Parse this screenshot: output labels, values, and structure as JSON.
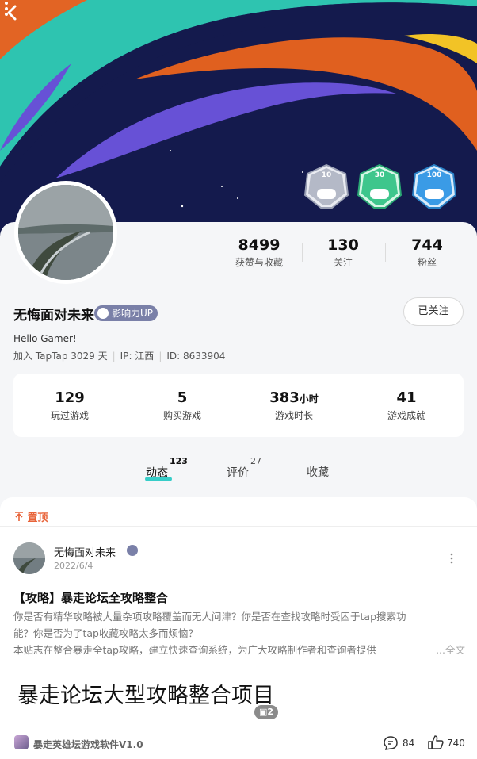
{
  "profile": {
    "name": "无悔面对未来",
    "badge": "影响力UP",
    "follow_label": "已关注",
    "bio": "Hello Gamer!",
    "join": "加入 TapTap 3029 天",
    "ip": "IP: 江西",
    "id": "ID: 8633904"
  },
  "achievements": [
    {
      "label": "10",
      "color": "#b4b9c7"
    },
    {
      "label": "30",
      "color": "#3ec68c"
    },
    {
      "label": "100",
      "color": "#3a9be6"
    }
  ],
  "stats": [
    {
      "value": "8499",
      "label": "获赞与收藏"
    },
    {
      "value": "130",
      "label": "关注"
    },
    {
      "value": "744",
      "label": "粉丝"
    }
  ],
  "game_stats": [
    {
      "value": "129",
      "unit": "",
      "label": "玩过游戏"
    },
    {
      "value": "5",
      "unit": "",
      "label": "购买游戏"
    },
    {
      "value": "383",
      "unit": "小时",
      "label": "游戏时长"
    },
    {
      "value": "41",
      "unit": "",
      "label": "游戏成就"
    }
  ],
  "tabs": [
    {
      "label": "动态",
      "count": "123"
    },
    {
      "label": "评价",
      "count": "27"
    },
    {
      "label": "收藏",
      "count": ""
    }
  ],
  "post": {
    "pin_label": "置顶",
    "author": "无悔面对未来",
    "date": "2022/6/4",
    "title": "【攻略】暴走论坛全攻略整合",
    "body_line1": "你是否有精华攻略被大量杂项攻略覆盖而无人问津？你是否在查找攻略时受困于tap搜索功",
    "body_line2": "能？你是否为了tap收藏攻略太多而烦恼？",
    "body_line3": "本贴志在整合暴走全tap攻略，建立快速查询系统，为广大攻略制作者和查询者提供",
    "more_label": "...全文",
    "image_text": "暴走论坛大型攻略整合项目",
    "image_count": "2",
    "game_name": "暴走英雄坛游戏软件V1.0",
    "comments": "84",
    "likes": "740"
  },
  "colors": {
    "accent": "#15c5c0",
    "pin": "#e8643a",
    "banner_bg": "#13184a"
  }
}
